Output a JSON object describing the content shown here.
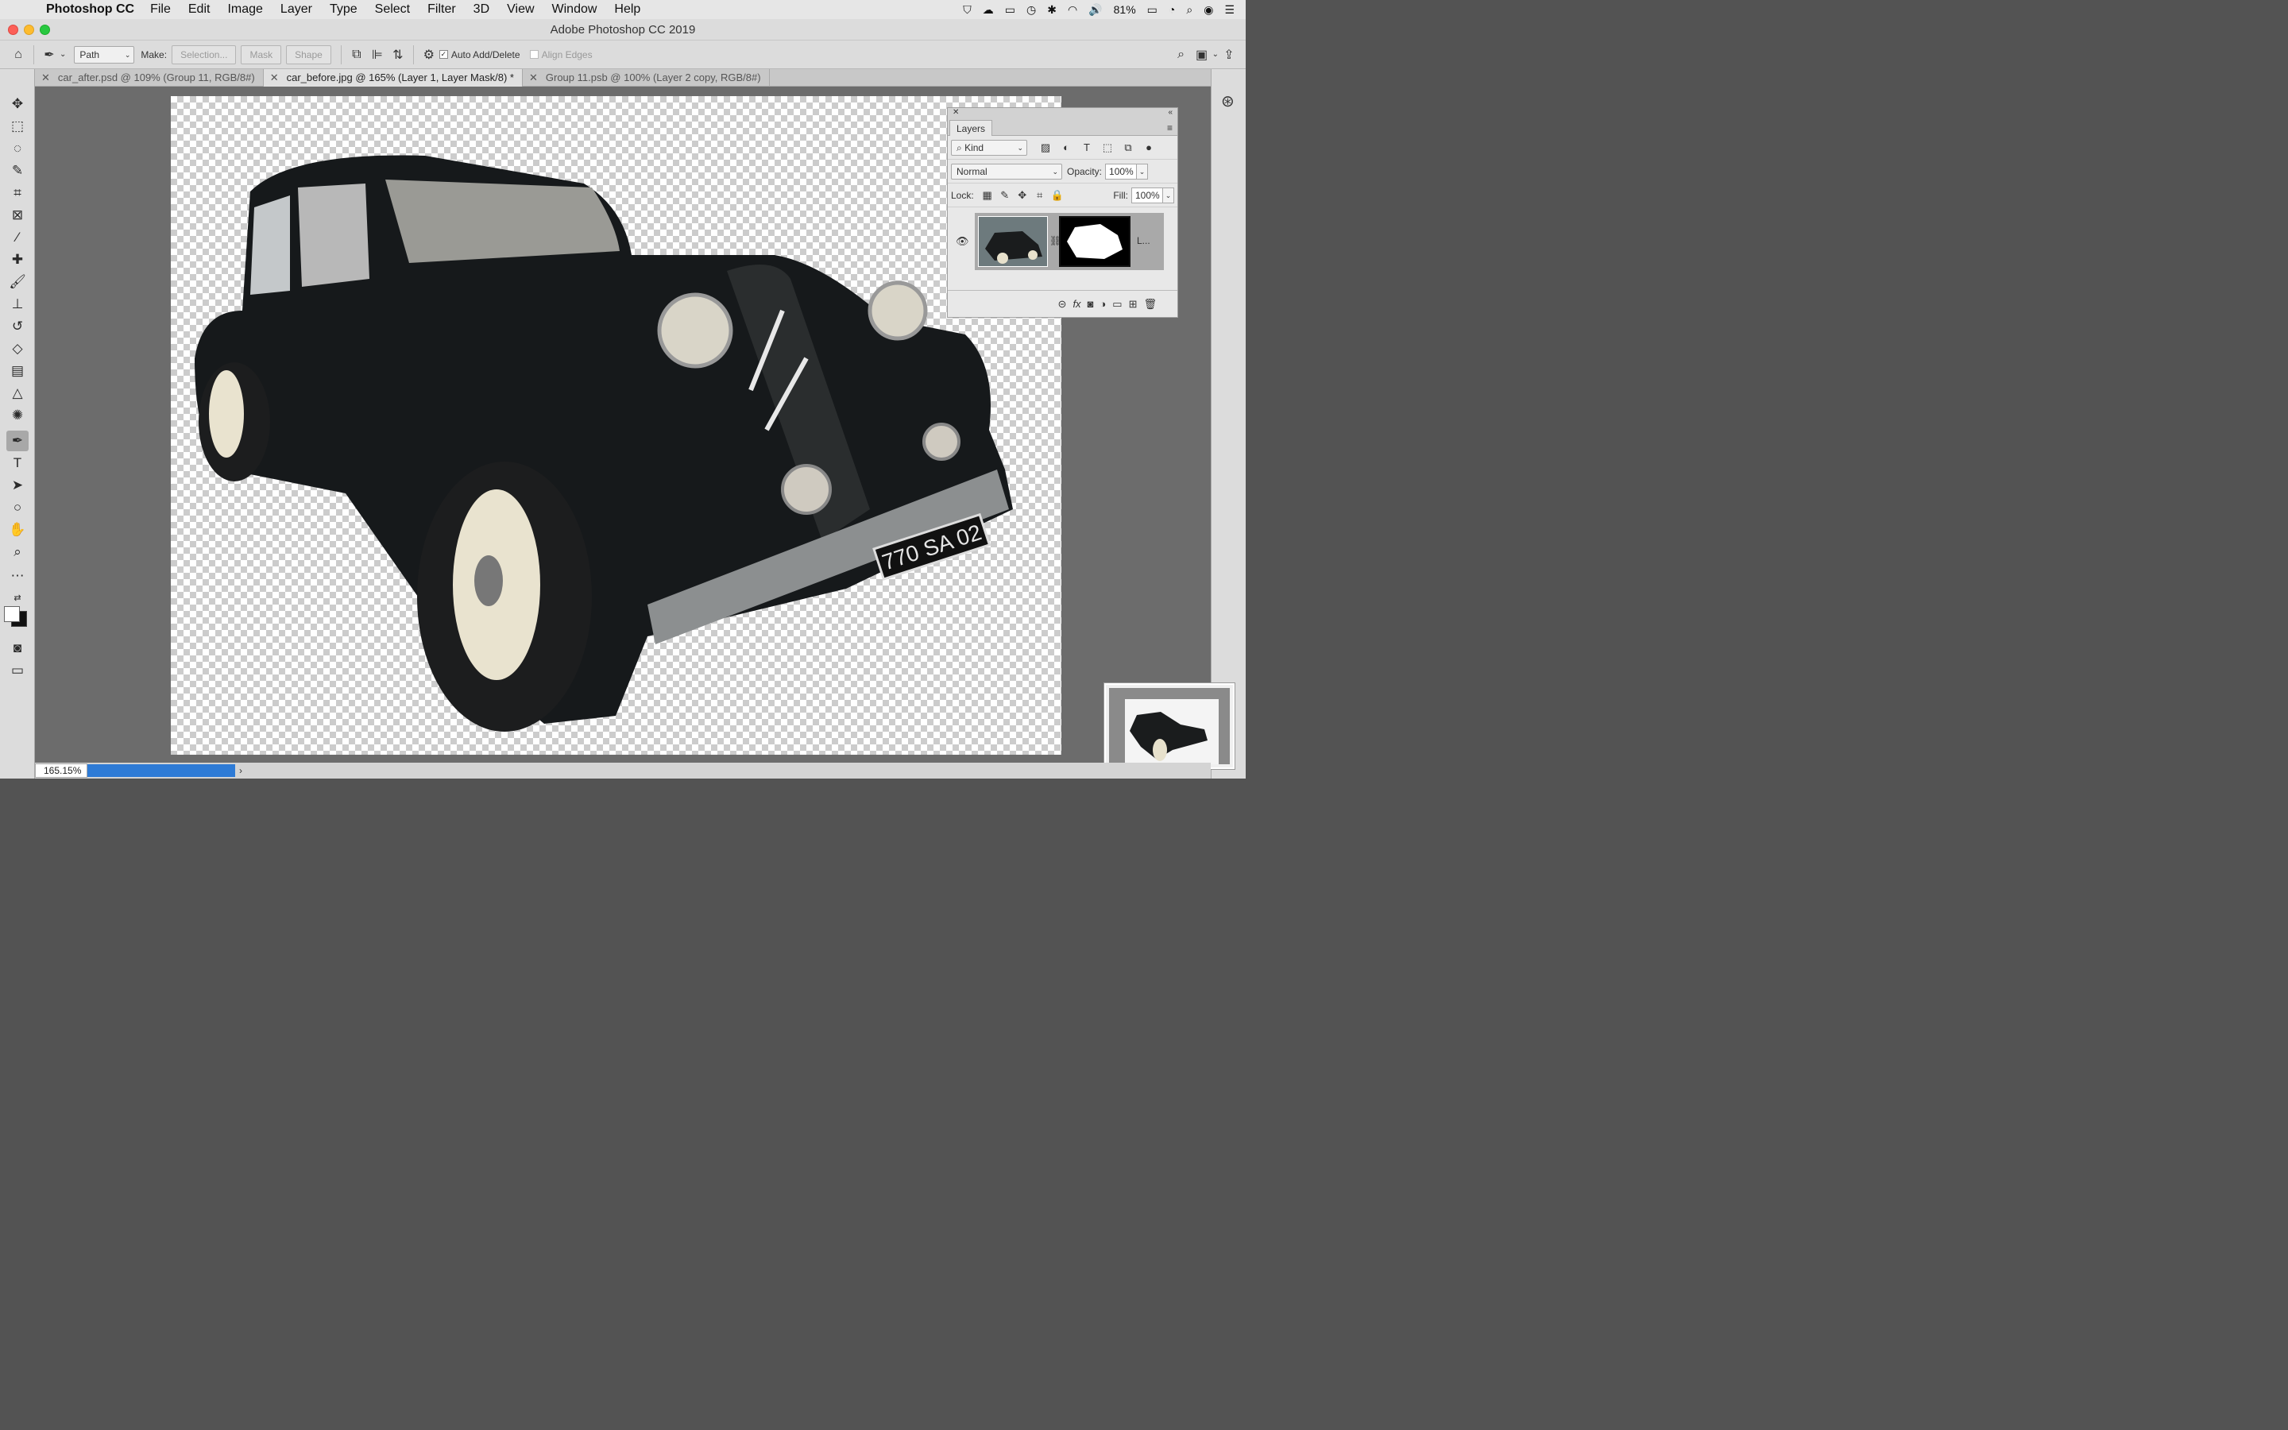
{
  "menubar": {
    "app": "Photoshop CC",
    "items": [
      "File",
      "Edit",
      "Image",
      "Layer",
      "Type",
      "Select",
      "Filter",
      "3D",
      "View",
      "Window",
      "Help"
    ],
    "battery": "81%"
  },
  "window": {
    "title": "Adobe Photoshop CC 2019"
  },
  "options": {
    "mode": "Path",
    "make_label": "Make:",
    "selection_btn": "Selection...",
    "mask_btn": "Mask",
    "shape_btn": "Shape",
    "auto_add_delete": "Auto Add/Delete",
    "align_edges": "Align Edges"
  },
  "tabs": [
    {
      "label": "car_after.psd @ 109% (Group 11, RGB/8#)"
    },
    {
      "label": "car_before.jpg @ 165% (Layer 1, Layer Mask/8) *"
    },
    {
      "label": "Group 11.psb @ 100% (Layer 2 copy, RGB/8#)"
    }
  ],
  "plate": "770 SA 02",
  "statusbar": {
    "zoom": "165.15%"
  },
  "layers": {
    "tab": "Layers",
    "filter": "Kind",
    "blend": "Normal",
    "opacity_label": "Opacity:",
    "opacity": "100%",
    "lock_label": "Lock:",
    "fill_label": "Fill:",
    "fill": "100%",
    "layer_name": "L..."
  }
}
